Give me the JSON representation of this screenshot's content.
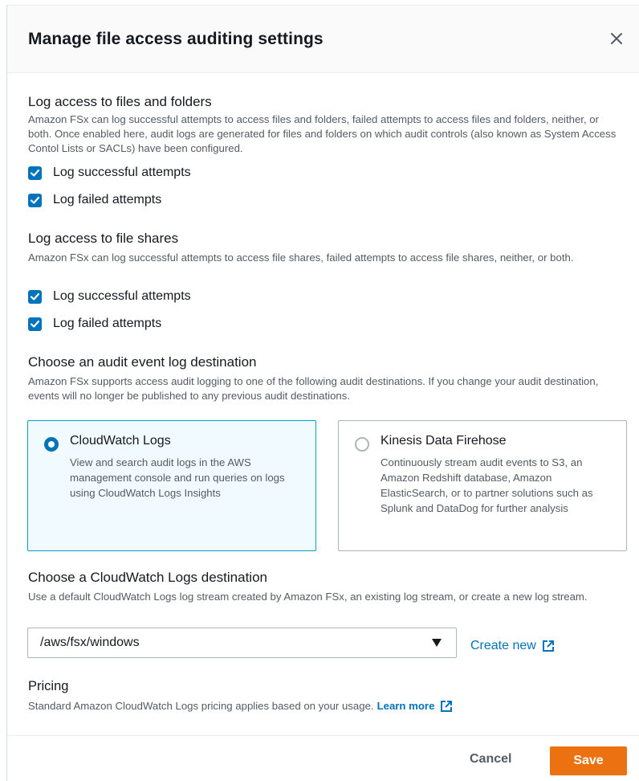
{
  "modal": {
    "title": "Manage file access auditing settings"
  },
  "files_section": {
    "title": "Log access to files and folders",
    "description": "Amazon FSx can log successful attempts to access files and folders, failed attempts to access files and folders, neither, or both. Once enabled here, audit logs are generated for files and folders on which audit controls (also known as System Access Contol Lists or SACLs) have been configured.",
    "successful_label": "Log successful attempts",
    "successful_checked": true,
    "failed_label": "Log failed attempts",
    "failed_checked": true
  },
  "shares_section": {
    "title": "Log access to file shares",
    "description": "Amazon FSx can log successful attempts to access file shares, failed attempts to access file shares, neither, or both.",
    "successful_label": "Log successful attempts",
    "successful_checked": true,
    "failed_label": "Log failed attempts",
    "failed_checked": true
  },
  "destination_section": {
    "title": "Choose an audit event log destination",
    "description": "Amazon FSx supports access audit logging to one of the following audit destinations. If you change your audit destination, events will no longer be published to any previous audit destinations.",
    "options": [
      {
        "title": "CloudWatch Logs",
        "description": "View and search audit logs in the AWS management console and run queries on logs using CloudWatch Logs Insights",
        "selected": true
      },
      {
        "title": "Kinesis Data Firehose",
        "description": "Continuously stream audit events to S3, an Amazon Redshift database, Amazon ElasticSearch, or to partner solutions such as Splunk and DataDog for further analysis",
        "selected": false
      }
    ]
  },
  "cloudwatch_section": {
    "title": "Choose a CloudWatch Logs destination",
    "description": "Use a default CloudWatch Logs log stream created by Amazon FSx, an existing log stream, or create a new log stream.",
    "select_value": "/aws/fsx/windows",
    "create_new_label": "Create new"
  },
  "pricing": {
    "title": "Pricing",
    "text": "Standard Amazon CloudWatch Logs pricing applies based on your usage.",
    "learn_more_label": "Learn more"
  },
  "footer": {
    "cancel_label": "Cancel",
    "save_label": "Save"
  },
  "colors": {
    "accent_blue": "#0073bb",
    "primary_orange": "#ec7211",
    "selected_tile_bg": "#f1faff",
    "selected_tile_border": "#00a1c9"
  },
  "icons": {
    "close": "close-icon",
    "checkbox": "check-icon",
    "caret": "caret-down-icon",
    "external": "external-link-icon"
  }
}
